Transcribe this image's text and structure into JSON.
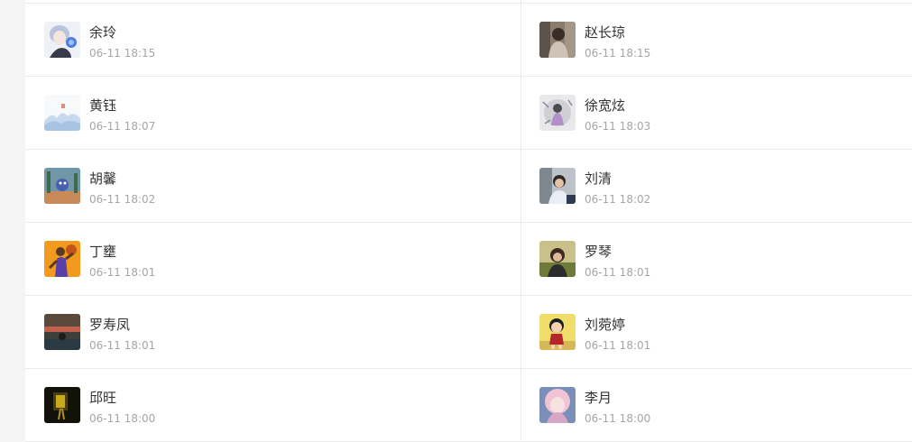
{
  "contacts": [
    {
      "name": "余玲",
      "time": "06-11 18:15",
      "avatar": "anime-girl-avatar-icon"
    },
    {
      "name": "赵长琼",
      "time": "06-11 18:15",
      "avatar": "photo-girl-avatar-icon"
    },
    {
      "name": "黄钰",
      "time": "06-11 18:07",
      "avatar": "mountain-sketch-avatar-icon"
    },
    {
      "name": "徐宽炫",
      "time": "06-11 18:03",
      "avatar": "ink-figure-avatar-icon"
    },
    {
      "name": "胡馨",
      "time": "06-11 18:02",
      "avatar": "cartoon-scene-avatar-icon"
    },
    {
      "name": "刘清",
      "time": "06-11 18:02",
      "avatar": "photo-boy-avatar-icon"
    },
    {
      "name": "丁壅",
      "time": "06-11 18:01",
      "avatar": "basketball-player-avatar-icon"
    },
    {
      "name": "罗琴",
      "time": "06-11 18:01",
      "avatar": "photo-woman-avatar-icon"
    },
    {
      "name": "罗寿凤",
      "time": "06-11 18:01",
      "avatar": "sunset-scene-avatar-icon"
    },
    {
      "name": "刘菀婷",
      "time": "06-11 18:01",
      "avatar": "cartoon-kid-avatar-icon"
    },
    {
      "name": "邱旺",
      "time": "06-11 18:00",
      "avatar": "dark-room-avatar-icon"
    },
    {
      "name": "李月",
      "time": "06-11 18:00",
      "avatar": "pink-hair-girl-avatar-icon"
    }
  ],
  "colors": {
    "name_text": "#333333",
    "time_text": "#a6a6a6",
    "divider": "#ebebeb",
    "page_bg": "#f5f5f5"
  }
}
